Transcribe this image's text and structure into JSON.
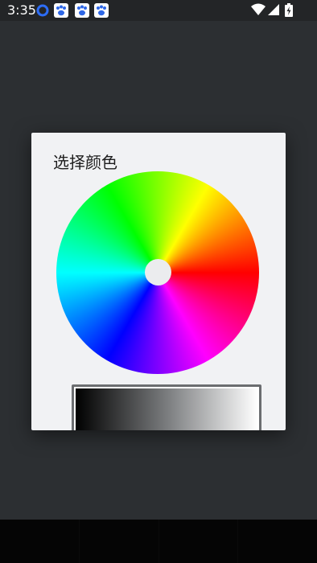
{
  "status_bar": {
    "time": "3:35",
    "notification_icons": [
      "browser-notification-icon",
      "paw-app-icon",
      "paw-app-icon",
      "paw-app-icon"
    ],
    "system_icons": [
      "wifi-icon",
      "signal-icon",
      "battery-charging-icon"
    ]
  },
  "dialog": {
    "title": "选择颜色"
  },
  "colors": {
    "status_bar_bg": "#232527",
    "app_bg": "#2c2f32",
    "dialog_bg": "#f1f2f4",
    "wheel_center": "#ebecee",
    "slider_border": "#6b6d70"
  }
}
